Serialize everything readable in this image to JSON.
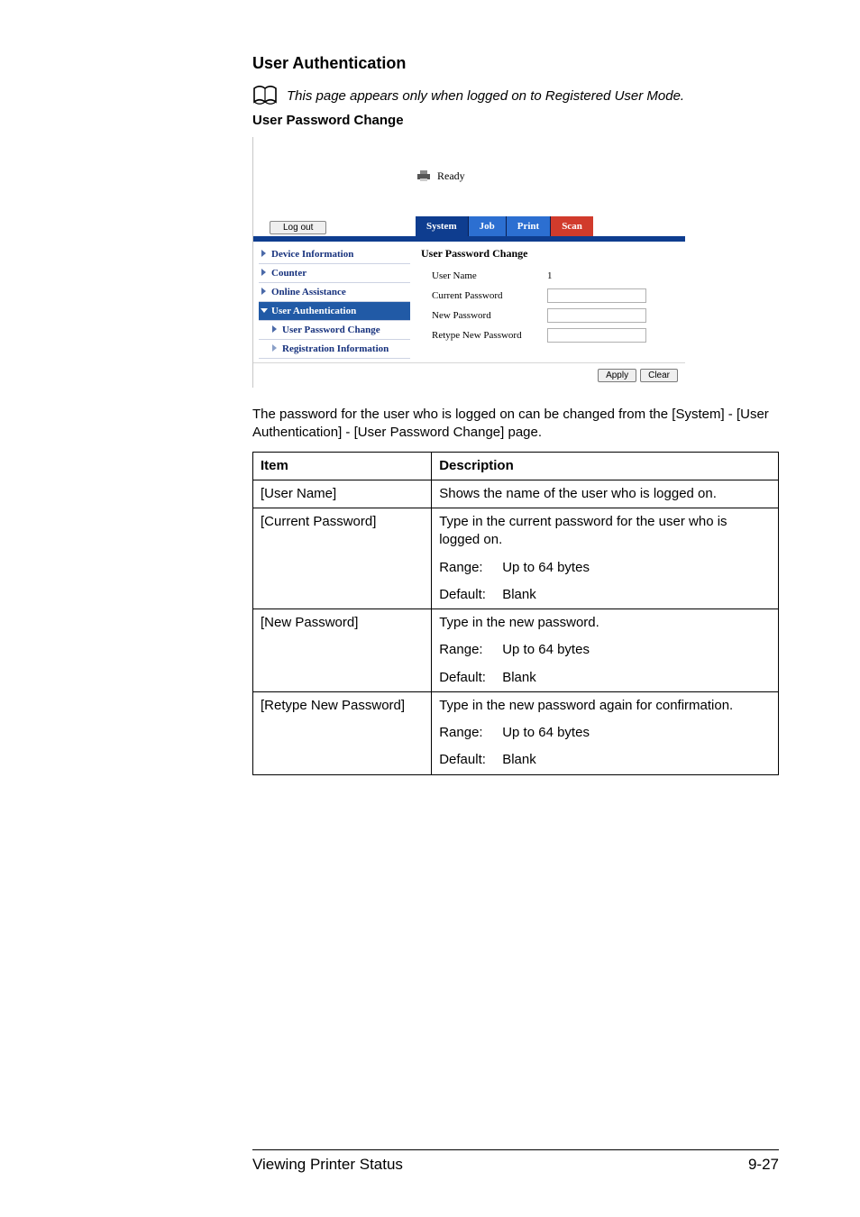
{
  "headings": {
    "main": "User Authentication",
    "note": "This page appears only when logged on to Registered User Mode.",
    "sub": "User Password Change"
  },
  "screenshot": {
    "status": "Ready",
    "logout": "Log out",
    "tabs": {
      "system": "System",
      "job": "Job",
      "print": "Print",
      "scan": "Scan"
    },
    "sidebar": {
      "device_info": "Device Information",
      "counter": "Counter",
      "online_assist": "Online Assistance",
      "user_auth": "User Authentication",
      "user_pw_change": "User Password Change",
      "reg_info": "Registration Information"
    },
    "content": {
      "title": "User Password Change",
      "user_name_label": "User Name",
      "user_name_value": "1",
      "current_pw": "Current Password",
      "new_pw": "New Password",
      "retype_pw": "Retype New Password"
    },
    "buttons": {
      "apply": "Apply",
      "clear": "Clear"
    }
  },
  "paragraph": "The password for the user who is logged on can be changed from the [System] - [User Authentication] - [User Password Change] page.",
  "table": {
    "head_item": "Item",
    "head_desc": "Description",
    "rows": [
      {
        "item": "[User Name]",
        "blocks": [
          {
            "text": "Shows the name of the user who is logged on."
          }
        ]
      },
      {
        "item": "[Current Password]",
        "blocks": [
          {
            "text": "Type in the current password for the user who is logged on."
          },
          {
            "kv": true,
            "label": "Range:",
            "value": "Up to 64 bytes"
          },
          {
            "kv": true,
            "label": "Default:",
            "value": "Blank"
          }
        ]
      },
      {
        "item": "[New Password]",
        "blocks": [
          {
            "text": "Type in the new password."
          },
          {
            "kv": true,
            "label": "Range:",
            "value": "Up to 64 bytes"
          },
          {
            "kv": true,
            "label": "Default:",
            "value": "Blank"
          }
        ]
      },
      {
        "item": "[Retype New Password]",
        "blocks": [
          {
            "text": "Type in the new password again for confirmation."
          },
          {
            "kv": true,
            "label": "Range:",
            "value": "Up to 64 bytes"
          },
          {
            "kv": true,
            "label": "Default:",
            "value": "Blank"
          }
        ]
      }
    ]
  },
  "footer": {
    "left": "Viewing Printer Status",
    "right": "9-27"
  }
}
